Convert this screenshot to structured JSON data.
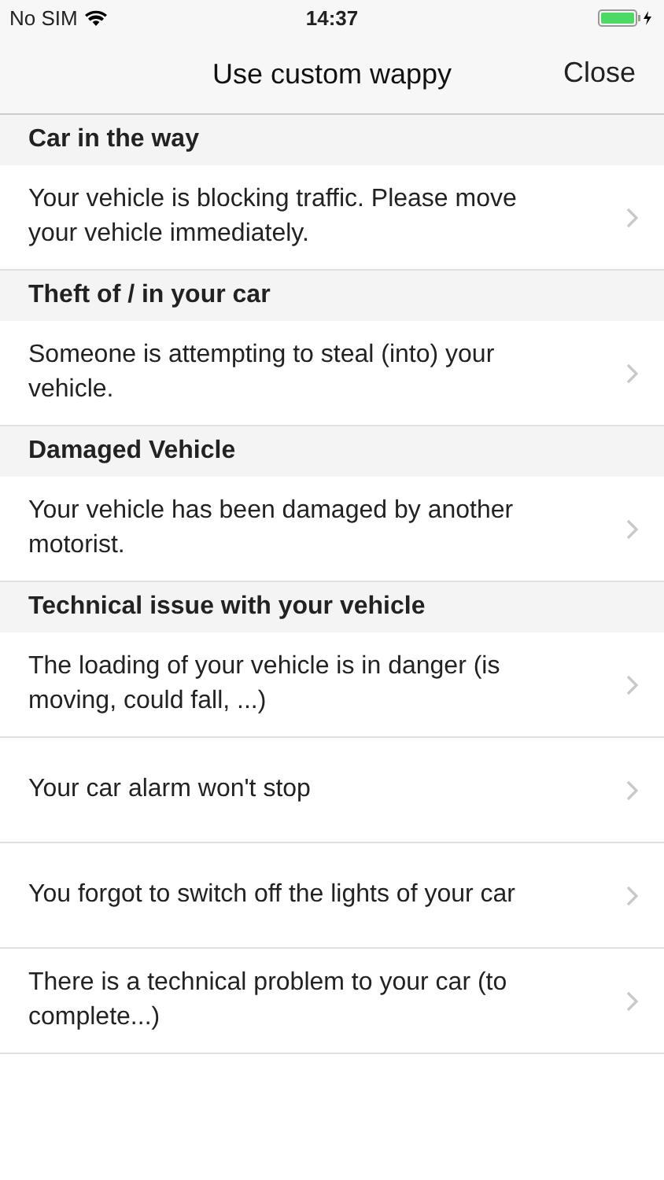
{
  "status_bar": {
    "carrier": "No SIM",
    "time": "14:37"
  },
  "nav": {
    "title": "Use custom wappy",
    "close": "Close"
  },
  "sections": [
    {
      "title": "Car in the way",
      "items": [
        "Your vehicle is blocking traffic. Please move your vehicle immediately."
      ]
    },
    {
      "title": "Theft of / in your car",
      "items": [
        "Someone is attempting to steal (into) your vehicle."
      ]
    },
    {
      "title": "Damaged Vehicle",
      "items": [
        "Your vehicle has been damaged by another motorist."
      ]
    },
    {
      "title": "Technical issue with your vehicle",
      "items": [
        "The loading of your vehicle is in danger (is moving, could fall, ...)",
        "Your car alarm won't stop",
        "You forgot to switch off the lights of your car",
        "There is a technical problem to your car (to complete...)"
      ]
    }
  ]
}
